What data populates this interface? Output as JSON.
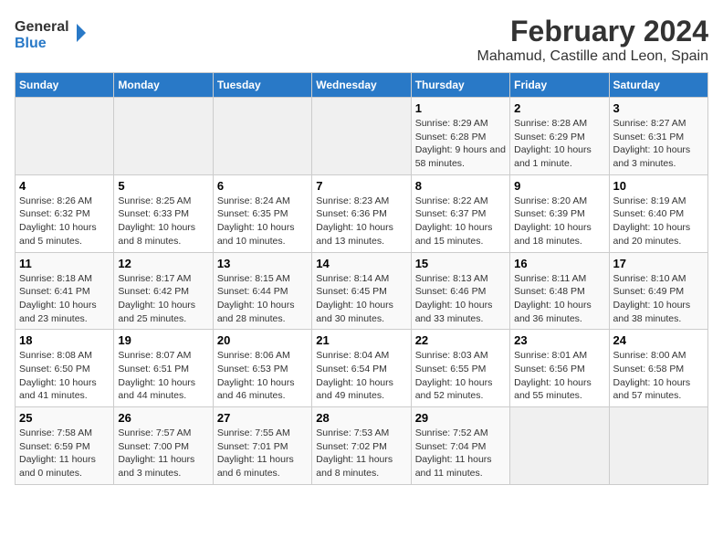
{
  "logo": {
    "line1": "General",
    "line2": "Blue"
  },
  "title": "February 2024",
  "subtitle": "Mahamud, Castille and Leon, Spain",
  "days_of_week": [
    "Sunday",
    "Monday",
    "Tuesday",
    "Wednesday",
    "Thursday",
    "Friday",
    "Saturday"
  ],
  "weeks": [
    [
      {
        "day": "",
        "info": ""
      },
      {
        "day": "",
        "info": ""
      },
      {
        "day": "",
        "info": ""
      },
      {
        "day": "",
        "info": ""
      },
      {
        "day": "1",
        "info": "Sunrise: 8:29 AM\nSunset: 6:28 PM\nDaylight: 9 hours and 58 minutes."
      },
      {
        "day": "2",
        "info": "Sunrise: 8:28 AM\nSunset: 6:29 PM\nDaylight: 10 hours and 1 minute."
      },
      {
        "day": "3",
        "info": "Sunrise: 8:27 AM\nSunset: 6:31 PM\nDaylight: 10 hours and 3 minutes."
      }
    ],
    [
      {
        "day": "4",
        "info": "Sunrise: 8:26 AM\nSunset: 6:32 PM\nDaylight: 10 hours and 5 minutes."
      },
      {
        "day": "5",
        "info": "Sunrise: 8:25 AM\nSunset: 6:33 PM\nDaylight: 10 hours and 8 minutes."
      },
      {
        "day": "6",
        "info": "Sunrise: 8:24 AM\nSunset: 6:35 PM\nDaylight: 10 hours and 10 minutes."
      },
      {
        "day": "7",
        "info": "Sunrise: 8:23 AM\nSunset: 6:36 PM\nDaylight: 10 hours and 13 minutes."
      },
      {
        "day": "8",
        "info": "Sunrise: 8:22 AM\nSunset: 6:37 PM\nDaylight: 10 hours and 15 minutes."
      },
      {
        "day": "9",
        "info": "Sunrise: 8:20 AM\nSunset: 6:39 PM\nDaylight: 10 hours and 18 minutes."
      },
      {
        "day": "10",
        "info": "Sunrise: 8:19 AM\nSunset: 6:40 PM\nDaylight: 10 hours and 20 minutes."
      }
    ],
    [
      {
        "day": "11",
        "info": "Sunrise: 8:18 AM\nSunset: 6:41 PM\nDaylight: 10 hours and 23 minutes."
      },
      {
        "day": "12",
        "info": "Sunrise: 8:17 AM\nSunset: 6:42 PM\nDaylight: 10 hours and 25 minutes."
      },
      {
        "day": "13",
        "info": "Sunrise: 8:15 AM\nSunset: 6:44 PM\nDaylight: 10 hours and 28 minutes."
      },
      {
        "day": "14",
        "info": "Sunrise: 8:14 AM\nSunset: 6:45 PM\nDaylight: 10 hours and 30 minutes."
      },
      {
        "day": "15",
        "info": "Sunrise: 8:13 AM\nSunset: 6:46 PM\nDaylight: 10 hours and 33 minutes."
      },
      {
        "day": "16",
        "info": "Sunrise: 8:11 AM\nSunset: 6:48 PM\nDaylight: 10 hours and 36 minutes."
      },
      {
        "day": "17",
        "info": "Sunrise: 8:10 AM\nSunset: 6:49 PM\nDaylight: 10 hours and 38 minutes."
      }
    ],
    [
      {
        "day": "18",
        "info": "Sunrise: 8:08 AM\nSunset: 6:50 PM\nDaylight: 10 hours and 41 minutes."
      },
      {
        "day": "19",
        "info": "Sunrise: 8:07 AM\nSunset: 6:51 PM\nDaylight: 10 hours and 44 minutes."
      },
      {
        "day": "20",
        "info": "Sunrise: 8:06 AM\nSunset: 6:53 PM\nDaylight: 10 hours and 46 minutes."
      },
      {
        "day": "21",
        "info": "Sunrise: 8:04 AM\nSunset: 6:54 PM\nDaylight: 10 hours and 49 minutes."
      },
      {
        "day": "22",
        "info": "Sunrise: 8:03 AM\nSunset: 6:55 PM\nDaylight: 10 hours and 52 minutes."
      },
      {
        "day": "23",
        "info": "Sunrise: 8:01 AM\nSunset: 6:56 PM\nDaylight: 10 hours and 55 minutes."
      },
      {
        "day": "24",
        "info": "Sunrise: 8:00 AM\nSunset: 6:58 PM\nDaylight: 10 hours and 57 minutes."
      }
    ],
    [
      {
        "day": "25",
        "info": "Sunrise: 7:58 AM\nSunset: 6:59 PM\nDaylight: 11 hours and 0 minutes."
      },
      {
        "day": "26",
        "info": "Sunrise: 7:57 AM\nSunset: 7:00 PM\nDaylight: 11 hours and 3 minutes."
      },
      {
        "day": "27",
        "info": "Sunrise: 7:55 AM\nSunset: 7:01 PM\nDaylight: 11 hours and 6 minutes."
      },
      {
        "day": "28",
        "info": "Sunrise: 7:53 AM\nSunset: 7:02 PM\nDaylight: 11 hours and 8 minutes."
      },
      {
        "day": "29",
        "info": "Sunrise: 7:52 AM\nSunset: 7:04 PM\nDaylight: 11 hours and 11 minutes."
      },
      {
        "day": "",
        "info": ""
      },
      {
        "day": "",
        "info": ""
      }
    ]
  ]
}
